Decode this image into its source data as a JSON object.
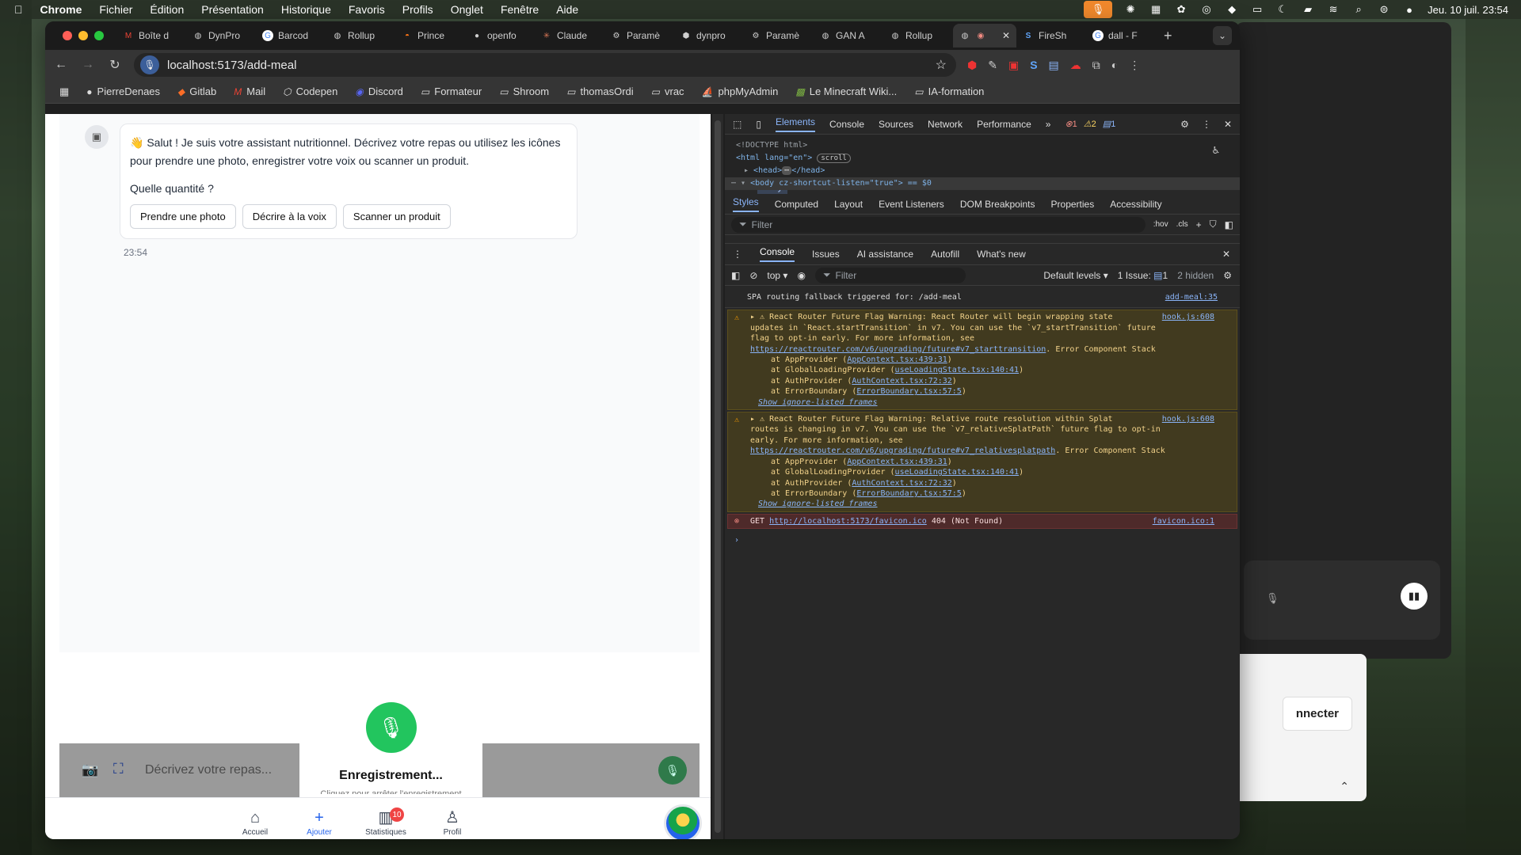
{
  "menubar": {
    "apple": "",
    "items": [
      "Chrome",
      "Fichier",
      "Édition",
      "Présentation",
      "Historique",
      "Favoris",
      "Profils",
      "Onglet",
      "Fenêtre",
      "Aide"
    ],
    "datetime": "Jeu. 10 juil.  23:54"
  },
  "browser": {
    "tabs": [
      {
        "label": "Boîte d",
        "icon": "gmail-icon"
      },
      {
        "label": "DynPro",
        "icon": "globe-icon"
      },
      {
        "label": "Barcod",
        "icon": "google-icon"
      },
      {
        "label": "Rollup",
        "icon": "globe-icon"
      },
      {
        "label": "Prince",
        "icon": "pizza-icon"
      },
      {
        "label": "openfo",
        "icon": "github-icon"
      },
      {
        "label": "Claude",
        "icon": "claude-icon"
      },
      {
        "label": "Paramè",
        "icon": "gear-icon"
      },
      {
        "label": "dynpro",
        "icon": "node-icon"
      },
      {
        "label": "Paramè",
        "icon": "gear-icon"
      },
      {
        "label": "GAN A",
        "icon": "globe-icon"
      },
      {
        "label": "Rollup",
        "icon": "globe-icon"
      },
      {
        "label": "",
        "icon": "globe-icon",
        "active": true
      },
      {
        "label": "FireSh",
        "icon": "fireship-icon"
      },
      {
        "label": "dall - F",
        "icon": "google-icon"
      }
    ],
    "url": "localhost:5173/add-meal",
    "bookmarks": [
      "PierreDenaes",
      "Gitlab",
      "Mail",
      "Codepen",
      "Discord",
      "Formateur",
      "Shroom",
      "thomasOrdi",
      "vrac",
      "phpMyAdmin",
      "Le Minecraft Wiki...",
      "IA-formation"
    ]
  },
  "app": {
    "greeting": "👋 Salut ! Je suis votre assistant nutritionnel. Décrivez votre repas ou utilisez les icônes pour prendre une photo, enregistrer votre voix ou scanner un produit.",
    "question": "Quelle quantité ?",
    "chips": [
      "Prendre une photo",
      "Décrire à la voix",
      "Scanner un produit"
    ],
    "time": "23:54",
    "input_placeholder": "Décrivez votre repas...",
    "recording_title": "Enregistrement...",
    "recording_sub": "Cliquez pour arrêter l'enregistrement",
    "nav": [
      {
        "label": "Accueil",
        "icon": "home-icon"
      },
      {
        "label": "Ajouter",
        "icon": "plus-icon",
        "active": true
      },
      {
        "label": "Statistiques",
        "icon": "stats-icon",
        "badge": "10"
      },
      {
        "label": "Profil",
        "icon": "user-icon"
      }
    ]
  },
  "devtools": {
    "tabs": [
      "Elements",
      "Console",
      "Sources",
      "Network",
      "Performance"
    ],
    "counts": {
      "errors": "1",
      "warnings": "2",
      "info": "1"
    },
    "dom": {
      "doctype": "<!DOCTYPE html>",
      "html": "<html lang=\"en\">",
      "scroll_badge": "scroll",
      "head": "<head>",
      "head_close": "</head>",
      "body": "<body cz-shortcut-listen=\"true\"> == $0"
    },
    "crumbs": [
      "html",
      "body"
    ],
    "sub_tabs": [
      "Styles",
      "Computed",
      "Layout",
      "Event Listeners",
      "DOM Breakpoints",
      "Properties",
      "Accessibility"
    ],
    "styles_filter": "Filter",
    "styles_tools": [
      ":hov",
      ".cls"
    ],
    "drawer_tabs": [
      "Console",
      "Issues",
      "AI assistance",
      "Autofill",
      "What's new"
    ],
    "console_context": "top",
    "console_filter": "Filter",
    "levels": "Default levels",
    "issues": "1 Issue:",
    "issues_count": "1",
    "hidden": "2 hidden",
    "messages": {
      "info": {
        "text": "SPA routing fallback triggered for: /add-meal",
        "src": "add-meal:35"
      },
      "w1": {
        "line1": "React Router Future Flag Warning: React Router will begin wrapping state",
        "line2": "updates in `React.startTransition` in v7. You can use the `v7_startTransition` future",
        "line3": "flag to opt-in early. For more information, see",
        "link": "https://reactrouter.com/v6/upgrading/future#v7_starttransition",
        "tail": ". Error Component Stack",
        "src": "hook.js:608"
      },
      "w2": {
        "line1": "React Router Future Flag Warning: Relative route resolution within Splat",
        "line2": "routes is changing in v7. You can use the `v7_relativeSplatPath` future flag to opt-in",
        "line3": "early. For more information, see",
        "link": "https://reactrouter.com/v6/upgrading/future#v7_relativesplatpath",
        "tail": ". Error Component Stack",
        "src": "hook.js:608"
      },
      "stack": [
        {
          "pre": "at AppProvider (",
          "file": "AppContext.tsx:439:31"
        },
        {
          "pre": "at GlobalLoadingProvider (",
          "file": "useLoadingState.tsx:140:41"
        },
        {
          "pre": "at AuthProvider (",
          "file": "AuthContext.tsx:72:32"
        },
        {
          "pre": "at ErrorBoundary (",
          "file": "ErrorBoundary.tsx:57:5"
        }
      ],
      "show_ignore": "Show ignore-listed frames",
      "err": {
        "method": "GET",
        "url": "http://localhost:5173/favicon.ico",
        "status": "404 (Not Found)",
        "src": "favicon.ico:1"
      }
    }
  },
  "bg_app": {
    "connect_label": "nnecter"
  },
  "colors": {
    "accent": "#2563eb",
    "mic_green": "#22c55e",
    "badge_red": "#ef4444"
  }
}
